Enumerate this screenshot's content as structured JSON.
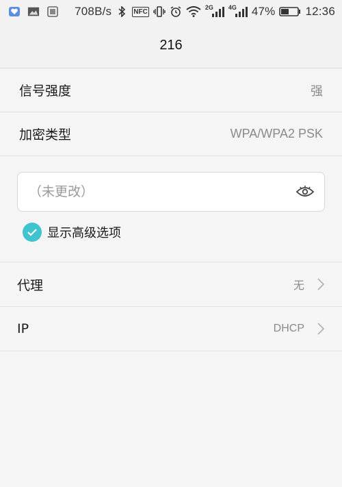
{
  "status_bar": {
    "net_speed": "708B/s",
    "nfc": "NFC",
    "net_2g": "2G",
    "net_4g": "4G",
    "battery_percent": "47%",
    "time": "12:36",
    "icons": [
      "app-heart-icon",
      "photo-icon",
      "gallery-icon",
      "bluetooth-icon",
      "nfc-icon",
      "vibrate-icon",
      "alarm-icon",
      "wifi-icon",
      "signal-2g-icon",
      "signal-4g-icon",
      "battery-icon"
    ]
  },
  "header": {
    "title": "216"
  },
  "info": {
    "signal_label": "信号强度",
    "signal_value": "强",
    "encryption_label": "加密类型",
    "encryption_value": "WPA/WPA2 PSK"
  },
  "password": {
    "placeholder": "（未更改）",
    "value": ""
  },
  "advanced": {
    "label": "显示高级选项",
    "checked": true
  },
  "proxy": {
    "label": "代理",
    "value": "无"
  },
  "ip": {
    "label": "IP",
    "value": "DHCP"
  },
  "colors": {
    "accent": "#3fc3cf",
    "background": "#f5f5f5"
  }
}
